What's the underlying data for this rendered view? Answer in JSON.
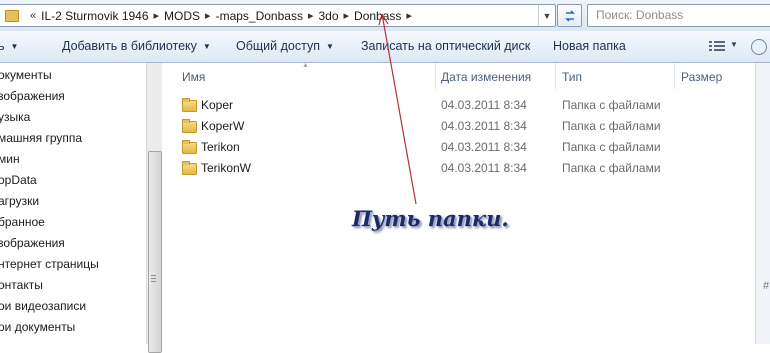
{
  "address_bar": {
    "overflow_chevron": "«",
    "crumbs": [
      "IL-2 Sturmovik 1946",
      "MODS",
      "-maps_Donbass",
      "3do",
      "Donbass"
    ],
    "separator": "▸",
    "dropdown_icon": "chevron-down-icon",
    "refresh_icon": "refresh-icon",
    "search_placeholder": "Поиск: Donbass"
  },
  "command_bar": {
    "organize_label": "ь",
    "add_to_library_label": "Добавить в библиотеку",
    "share_label": "Общий доступ",
    "burn_label": "Записать на оптический диск",
    "new_folder_label": "Новая папка"
  },
  "nav_pane": {
    "items": [
      "окументы",
      "зображения",
      "узыка",
      "машняя группа",
      "мин",
      "opData",
      "агрузки",
      "бранное",
      "зображения",
      "нтернет страницы",
      "онтакты",
      "ои видеозаписи",
      "ои документы"
    ]
  },
  "file_list": {
    "columns": {
      "name": "Имя",
      "date": "Дата изменения",
      "type": "Тип",
      "size": "Размер"
    },
    "rows": [
      {
        "name": "Koper",
        "date": "04.03.2011 8:34",
        "type": "Папка с файлами"
      },
      {
        "name": "KoperW",
        "date": "04.03.2011 8:34",
        "type": "Папка с файлами"
      },
      {
        "name": "Terikon",
        "date": "04.03.2011 8:34",
        "type": "Папка с файлами"
      },
      {
        "name": "TerikonW",
        "date": "04.03.2011 8:34",
        "type": "Папка с файлами"
      }
    ]
  },
  "details_pane": {
    "glyph": "#"
  },
  "annotation": {
    "text": "Путь папки.",
    "color": "#1d2a6a",
    "arrow_color": "#b0303a"
  }
}
